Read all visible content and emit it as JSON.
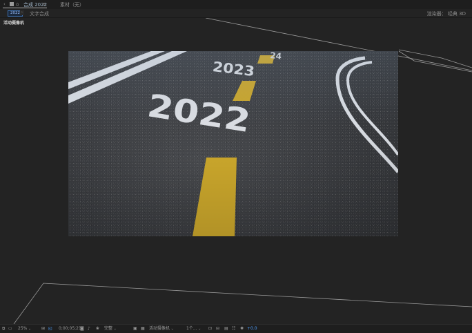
{
  "tabbar": {
    "menu_icon": "‹",
    "lock_icon": "🔒",
    "comp_tab_label": "合成 2022",
    "hamburger": "≡",
    "footage_tab_label": "素材（无）"
  },
  "subbar": {
    "crumb_active": "2022",
    "crumb_arrow": "›",
    "crumb_second": "文字合成",
    "renderer": "渲染器：  经典 3D"
  },
  "viewport": {
    "camera_label": "活动摄像机"
  },
  "image": {
    "text_2022": "2022",
    "text_2023": "2023",
    "text_2024": "24"
  },
  "toolbar": {
    "zoom": "25%",
    "timecode": "0;00;05;21",
    "resolution": "完整",
    "camera": "活动摄像机",
    "views": "1个...",
    "exposure": "+0.0"
  }
}
